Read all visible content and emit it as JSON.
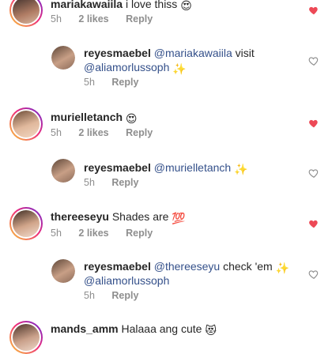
{
  "comments": [
    {
      "user": "mariakawaiila",
      "text": "i love thiss",
      "emoji": "😍",
      "time": "5h",
      "likes": "2 likes",
      "reply": "Reply",
      "liked": true
    },
    {
      "user": "reyesmaebel",
      "mention": "@mariakawaiila",
      "text": "visit",
      "mention2": "@aliamorlussoph",
      "emoji": "✨",
      "time": "5h",
      "reply": "Reply",
      "liked": false
    },
    {
      "user": "murielletanch",
      "emoji": "😍",
      "time": "5h",
      "likes": "2 likes",
      "reply": "Reply",
      "liked": true
    },
    {
      "user": "reyesmaebel",
      "mention": "@murielletanch",
      "emoji": "✨",
      "time": "5h",
      "reply": "Reply",
      "liked": false
    },
    {
      "user": "thereeseyu",
      "text": "Shades are",
      "emoji": "💯",
      "time": "5h",
      "likes": "2 likes",
      "reply": "Reply",
      "liked": true
    },
    {
      "user": "reyesmaebel",
      "mention": "@thereeseyu",
      "text": "check 'em",
      "mention2": "@aliamorlussoph",
      "emoji": "✨",
      "time": "5h",
      "reply": "Reply",
      "liked": false
    },
    {
      "user": "mands_amm",
      "text": "Halaaa ang cute",
      "emoji": "😻"
    }
  ],
  "colors": {
    "heart_liked": "#ed4956",
    "heart_outline": "#8e8e8e",
    "mention": "#34508a"
  }
}
